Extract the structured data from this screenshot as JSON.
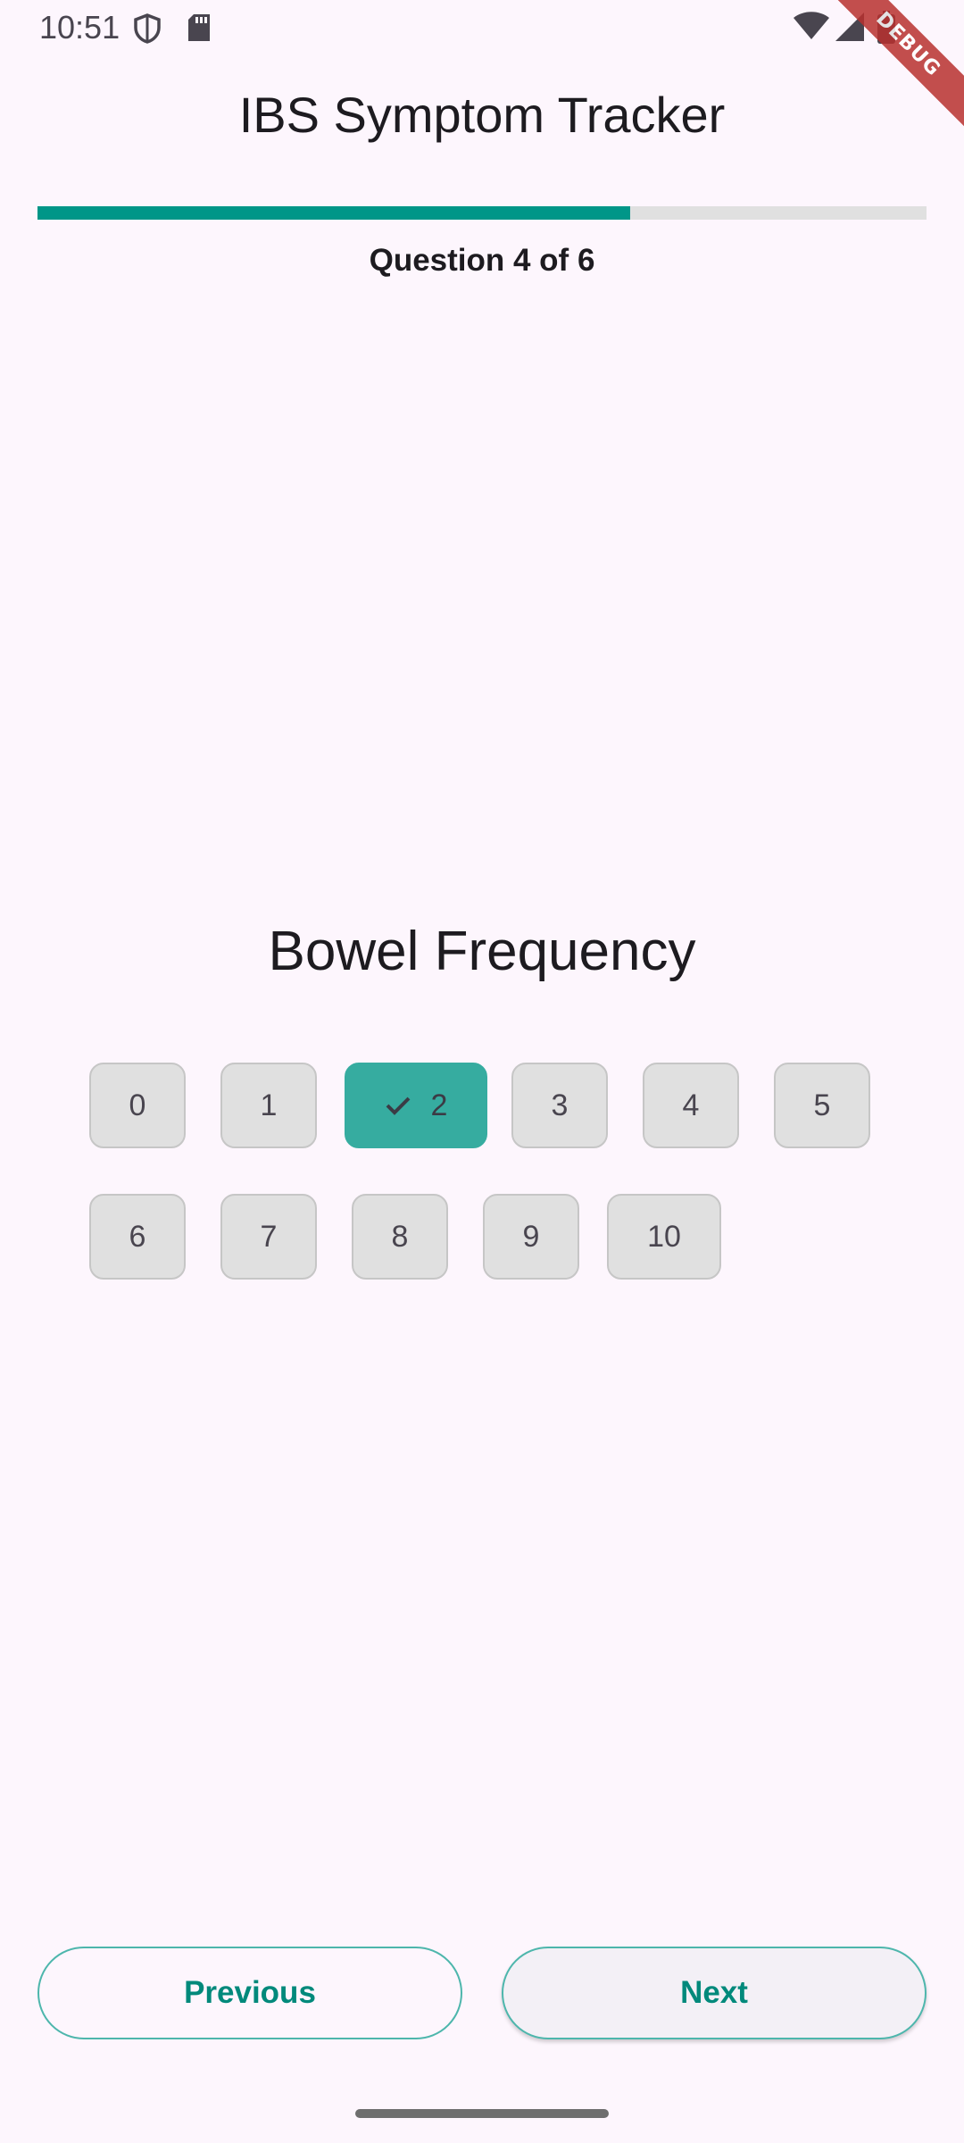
{
  "status_bar": {
    "time": "10:51",
    "left_icons": [
      "shield-icon",
      "sd-card-icon"
    ],
    "right_icons": [
      "wifi-icon",
      "signal-icon",
      "battery-icon"
    ]
  },
  "debug_banner": "DEBUG",
  "app_bar": {
    "title": "IBS Symptom Tracker"
  },
  "progress": {
    "current": 4,
    "total": 6,
    "fraction": 0.667,
    "label": "Question 4 of 6",
    "fill_color": "#009688",
    "track_color": "#e0e0e0"
  },
  "question": {
    "title": "Bowel Frequency",
    "options": [
      "0",
      "1",
      "2",
      "3",
      "4",
      "5",
      "6",
      "7",
      "8",
      "9",
      "10"
    ],
    "selected": "2",
    "selected_color": "#36aca0"
  },
  "navigation": {
    "previous_label": "Previous",
    "next_label": "Next",
    "accent": "#00897b"
  }
}
